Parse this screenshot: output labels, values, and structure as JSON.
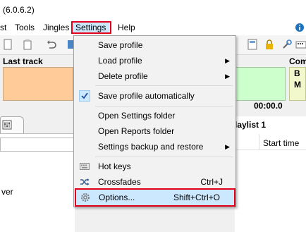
{
  "window": {
    "title": "(6.0.6.2)"
  },
  "menubar": {
    "items": [
      {
        "label": "st"
      },
      {
        "label": "Tools"
      },
      {
        "label": "Jingles"
      },
      {
        "label": "Settings"
      },
      {
        "label": "Help"
      }
    ],
    "right_icon": "info-icon"
  },
  "panels": {
    "last_track_label": "Last track",
    "comm_label": "Com",
    "comm_box_lines": [
      "B",
      "M"
    ],
    "time": "00:00.0"
  },
  "left": {
    "label": "ver"
  },
  "playlist": {
    "title": "laylist 1",
    "column_start_time": "Start time"
  },
  "settings_menu": {
    "items": [
      {
        "label": "Save profile",
        "submenu": false
      },
      {
        "label": "Load profile",
        "submenu": true
      },
      {
        "label": "Delete profile",
        "submenu": true
      },
      {
        "label": "Save profile automatically",
        "checked": true
      },
      {
        "label": "Open Settings folder"
      },
      {
        "label": "Open Reports folder"
      },
      {
        "label": "Settings backup and restore",
        "submenu": true
      },
      {
        "label": "Hot keys",
        "icon": "keyboard-icon"
      },
      {
        "label": "Crossfades",
        "shortcut": "Ctrl+J",
        "icon": "shuffle-icon"
      },
      {
        "label": "Options...",
        "shortcut": "Shift+Ctrl+O",
        "icon": "gear-icon"
      }
    ]
  },
  "colors": {
    "highlight_border": "#e3001b",
    "highlight_fill": "#cce8ff",
    "last_track_fill": "#ffcc99",
    "next_fill": "#ccffcc",
    "comm_fill": "#f2f8cc"
  }
}
